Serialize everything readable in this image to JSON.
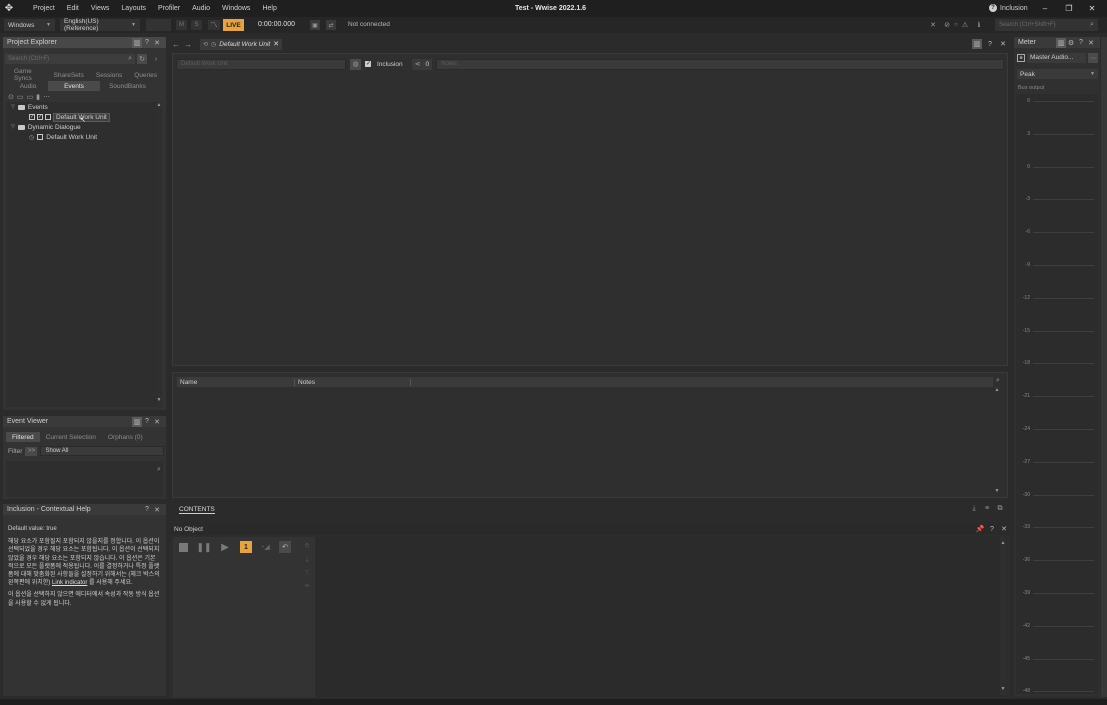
{
  "titlebar": {
    "menus": [
      "Project",
      "Edit",
      "Views",
      "Layouts",
      "Profiler",
      "Audio",
      "Windows",
      "Help"
    ],
    "title": "Test - Wwise 2022.1.6",
    "help_topic": "Inclusion"
  },
  "toolbar": {
    "platform": "Windows",
    "language": "English(US) (Reference)",
    "m_label": "M",
    "s_label": "S",
    "live_label": "LIVE",
    "time": "0:00:00.000",
    "connection": "Not connected",
    "search_placeholder": "Search (Ctrl+Shift+F)"
  },
  "project_explorer": {
    "title": "Project Explorer",
    "search_placeholder": "Search (Ctrl+F)",
    "tabs_row1": [
      "Game Syncs",
      "ShareSets",
      "Sessions",
      "Queries"
    ],
    "tabs_row2": [
      "Audio",
      "Events",
      "SoundBanks"
    ],
    "active_tab": "Events",
    "tree": {
      "events": "Events",
      "events_wu": "Default Work Unit",
      "dynamic_dialogue": "Dynamic Dialogue",
      "dd_wu": "Default Work Unit"
    }
  },
  "event_viewer": {
    "title": "Event Viewer",
    "tabs": [
      "Filtered",
      "Current Selection",
      "Orphans (0)"
    ],
    "filter_label": "Filter",
    "filter_btn": ">>",
    "filter_value": "Show All"
  },
  "contextual_help": {
    "title": "Inclusion - Contextual Help",
    "default_value": "Default value: true",
    "para1_a": "해당 요소가 포함될지 포함되지 않을지를 정합니다. 이 옵션이 선택되었을 경우 해당 요소는 포함됩니다. 이 옵션이 선택되지 않았을 경우 해당 요소는 포함되지 않습니다. 이 옵션은 기본적으로 모든 플랫폼에 적용됩니다. 이를 결정하거나 특정 플랫폼에 대해 맞춤화된 사항들을 설정하기 위해서는 (체크 박스의 왼쪽편에 위치한)",
    "link": "Link indicator",
    "para1_b": "를 사용해 주세요.",
    "para2": "이 옵션을 선택하지 않으면 에디터에서 속성과 작동 방식 옵션을 사용할 수 없게 됩니다."
  },
  "editor": {
    "tab_label": "Default Work Unit",
    "name_placeholder": "Default Work Unit",
    "inclusion_label": "Inclusion",
    "inclusion_checked": true,
    "count": "0",
    "notes_placeholder": "Notes",
    "columns": [
      "Name",
      "Notes"
    ]
  },
  "contents": {
    "label": "CONTENTS"
  },
  "transport": {
    "object_label": "No Object",
    "slot_label": "1"
  },
  "meter": {
    "title": "Meter",
    "bus": "Master Audio...",
    "mode": "Peak",
    "bus_output": "Bus output",
    "scale": [
      "6",
      "3",
      "0",
      "-3",
      "-6",
      "-9",
      "-12",
      "-15",
      "-18",
      "-21",
      "-24",
      "-27",
      "-30",
      "-33",
      "-36",
      "-39",
      "-42",
      "-45",
      "-48"
    ]
  },
  "colors": {
    "accent": "#e8a33d",
    "bg": "#2b2b2b",
    "panel": "#333333",
    "titlebar": "#1f1f1f"
  }
}
